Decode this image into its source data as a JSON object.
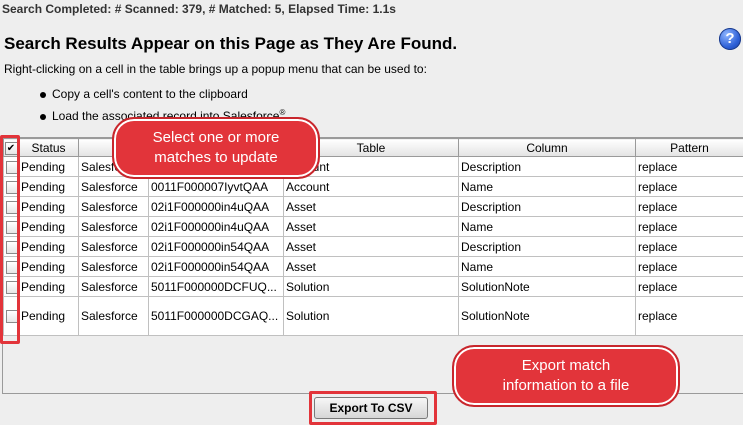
{
  "status_line": "Search Completed: # Scanned: 379, # Matched: 5, Elapsed Time: 1.1s",
  "heading": "Search Results Appear on this Page as They Are Found.",
  "help_icon_glyph": "?",
  "description": "Right-clicking on a cell in the table brings up a popup menu that can be used to:",
  "bullets": [
    "Copy a cell's content to the clipboard",
    "Load the associated record into Salesforce"
  ],
  "bullet_superscript": "®",
  "table": {
    "header_check": "✔",
    "columns": [
      "Status",
      "",
      "",
      "Table",
      "Column",
      "Pattern"
    ],
    "rows": [
      {
        "status": "Pending",
        "source": "Salesforce",
        "id": "",
        "table": "Account",
        "column": "Description",
        "pattern": "replace"
      },
      {
        "status": "Pending",
        "source": "Salesforce",
        "id": "0011F000007IyvtQAA",
        "table": "Account",
        "column": "Name",
        "pattern": "replace"
      },
      {
        "status": "Pending",
        "source": "Salesforce",
        "id": "02i1F000000in4uQAA",
        "table": "Asset",
        "column": "Description",
        "pattern": "replace"
      },
      {
        "status": "Pending",
        "source": "Salesforce",
        "id": "02i1F000000in4uQAA",
        "table": "Asset",
        "column": "Name",
        "pattern": "replace"
      },
      {
        "status": "Pending",
        "source": "Salesforce",
        "id": "02i1F000000in54QAA",
        "table": "Asset",
        "column": "Description",
        "pattern": "replace"
      },
      {
        "status": "Pending",
        "source": "Salesforce",
        "id": "02i1F000000in54QAA",
        "table": "Asset",
        "column": "Name",
        "pattern": "replace"
      },
      {
        "status": "Pending",
        "source": "Salesforce",
        "id": "5011F000000DCFUQ...",
        "table": "Solution",
        "column": "SolutionNote",
        "pattern": "replace"
      },
      {
        "status": "Pending",
        "source": "Salesforce",
        "id": "5011F000000DCGAQ...",
        "table": "Solution",
        "column": "SolutionNote",
        "pattern": "replace"
      }
    ]
  },
  "export_button": "Export To CSV",
  "callouts": {
    "select": [
      "Select one or more",
      "matches to update"
    ],
    "export": [
      "Export match",
      "information to a file"
    ]
  },
  "colors": {
    "annotation_red": "#e2343a",
    "help_blue": "#2c5fd6"
  }
}
